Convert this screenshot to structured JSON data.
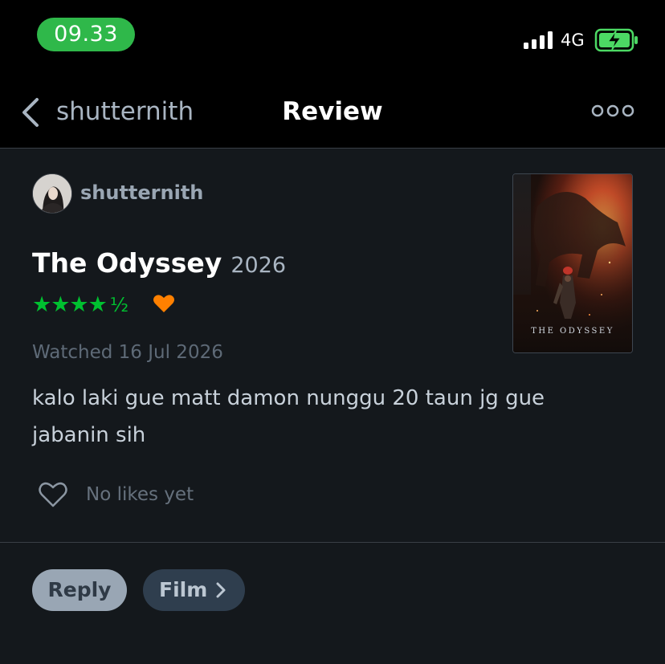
{
  "status_bar": {
    "time": "09.33",
    "network": "4G",
    "icons": [
      "signal-icon",
      "battery-charging-icon"
    ]
  },
  "nav": {
    "back_label": "shutternith",
    "title": "Review",
    "icons": [
      "chevron-left-icon",
      "more-options-icon"
    ]
  },
  "review": {
    "author": "shutternith",
    "film_title": "The Odyssey",
    "film_year": "2026",
    "rating_stars": "★★★★",
    "rating_half": "½",
    "rating_value": 4.5,
    "liked": true,
    "watched": "Watched 16 Jul 2026",
    "body": "kalo laki gue matt damon nunggu 20 taun jg gue jabanin sih",
    "likes_text": "No likes yet",
    "poster_text": "THE ODYSSEY"
  },
  "actions": {
    "reply_label": "Reply",
    "film_label": "Film"
  },
  "colors": {
    "time_pill": "#2fb84a",
    "star_green": "#00c030",
    "heart_orange": "#ff8000",
    "background": "#14181c",
    "reply_bg": "#99a6b4",
    "film_bg": "#2f3e4e"
  }
}
